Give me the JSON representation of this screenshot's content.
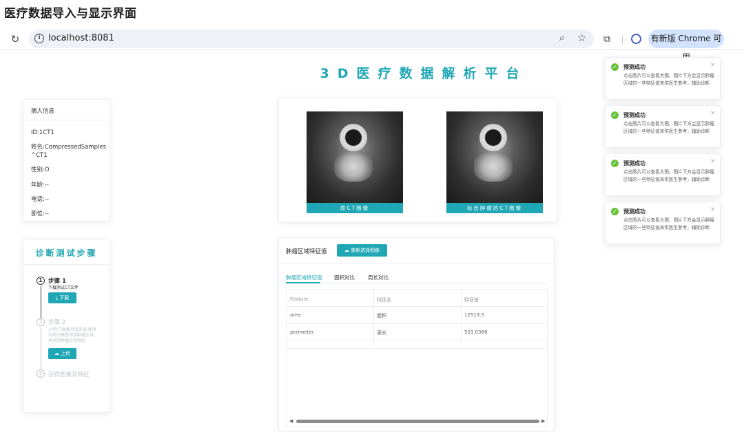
{
  "caption": "医疗数据导入与显示界面",
  "browser": {
    "url": "localhost:8081",
    "update_label": "有新版 Chrome 可用",
    "icons": {
      "reload": "↻",
      "info": "i",
      "zoom": "⌕",
      "star": "☆",
      "extensions": "⧉"
    }
  },
  "page_title": "3D医疗数据解析平台",
  "patient": {
    "header": "病人信息",
    "fields": [
      "ID:1CT1",
      "姓名:CompressedSamples^CT1",
      "性别:O",
      "年龄:--",
      "电话:--",
      "部位:--"
    ]
  },
  "steps": {
    "title": "诊断测试步骤",
    "items": [
      {
        "num": "1",
        "title": "步骤 1",
        "desc": "下载测试CT文件",
        "button": "下载",
        "button_icon": "⤓",
        "state": "active"
      },
      {
        "num": "2",
        "title": "步骤 2",
        "desc": "上传CT图像至服务器,使用训练的模型预测肿瘤区域并返回肿瘤区域特征",
        "button": "上传",
        "button_icon": "☁",
        "state": "pending"
      },
      {
        "num": "3",
        "title": "获得图像及特征",
        "state": "pending"
      }
    ]
  },
  "images": {
    "original_caption": "原CT图像",
    "marked_caption": "标出肿瘤的CT图像"
  },
  "features": {
    "title": "肿瘤区域特征值",
    "reselect_button": "重新选择图像",
    "reselect_icon": "☁",
    "tabs": [
      "肿瘤区域特征值",
      "面积对比",
      "周长对比"
    ],
    "active_tab": 0,
    "table": {
      "headers": [
        "Feature",
        "特征名",
        "特征值"
      ],
      "rows": [
        [
          "area",
          "面积",
          "12519.5"
        ],
        [
          "perimeter",
          "周长",
          "503.0366"
        ]
      ]
    },
    "scroll_arrows": [
      "◀",
      "▶"
    ]
  },
  "notifications": [
    {
      "title": "预测成功",
      "message": "点击图片可以查看大图，图片下方会显示肿瘤区域的一些特征值来供医生参考，辅助诊断"
    },
    {
      "title": "预测成功",
      "message": "点击图片可以查看大图，图片下方会显示肿瘤区域的一些特征值来供医生参考，辅助诊断"
    },
    {
      "title": "预测成功",
      "message": "点击图片可以查看大图，图片下方会显示肿瘤区域的一些特征值来供医生参考，辅助诊断"
    },
    {
      "title": "预测成功",
      "message": "点击图片可以查看大图，图片下方会显示肿瘤区域的一些特征值来供医生参考，辅助诊断"
    }
  ],
  "colors": {
    "accent": "#20a7b5",
    "success": "#67c23a"
  }
}
